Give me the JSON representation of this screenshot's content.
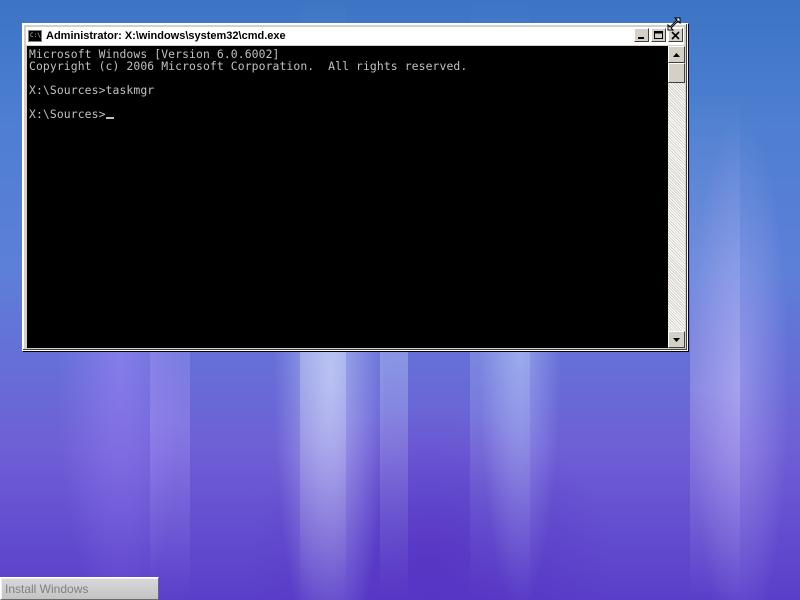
{
  "window": {
    "title": "Administrator: X:\\windows\\system32\\cmd.exe",
    "icon": "cmd-icon",
    "icon_glyph": "C:\\"
  },
  "console": {
    "lines": [
      "Microsoft Windows [Version 6.0.6002]",
      "Copyright (c) 2006 Microsoft Corporation.  All rights reserved.",
      "",
      "X:\\Sources>taskmgr",
      "",
      "X:\\Sources>"
    ],
    "text_color": "#c0c0c0",
    "background_color": "#000000"
  },
  "taskbar": {
    "button_label": "Install Windows"
  }
}
